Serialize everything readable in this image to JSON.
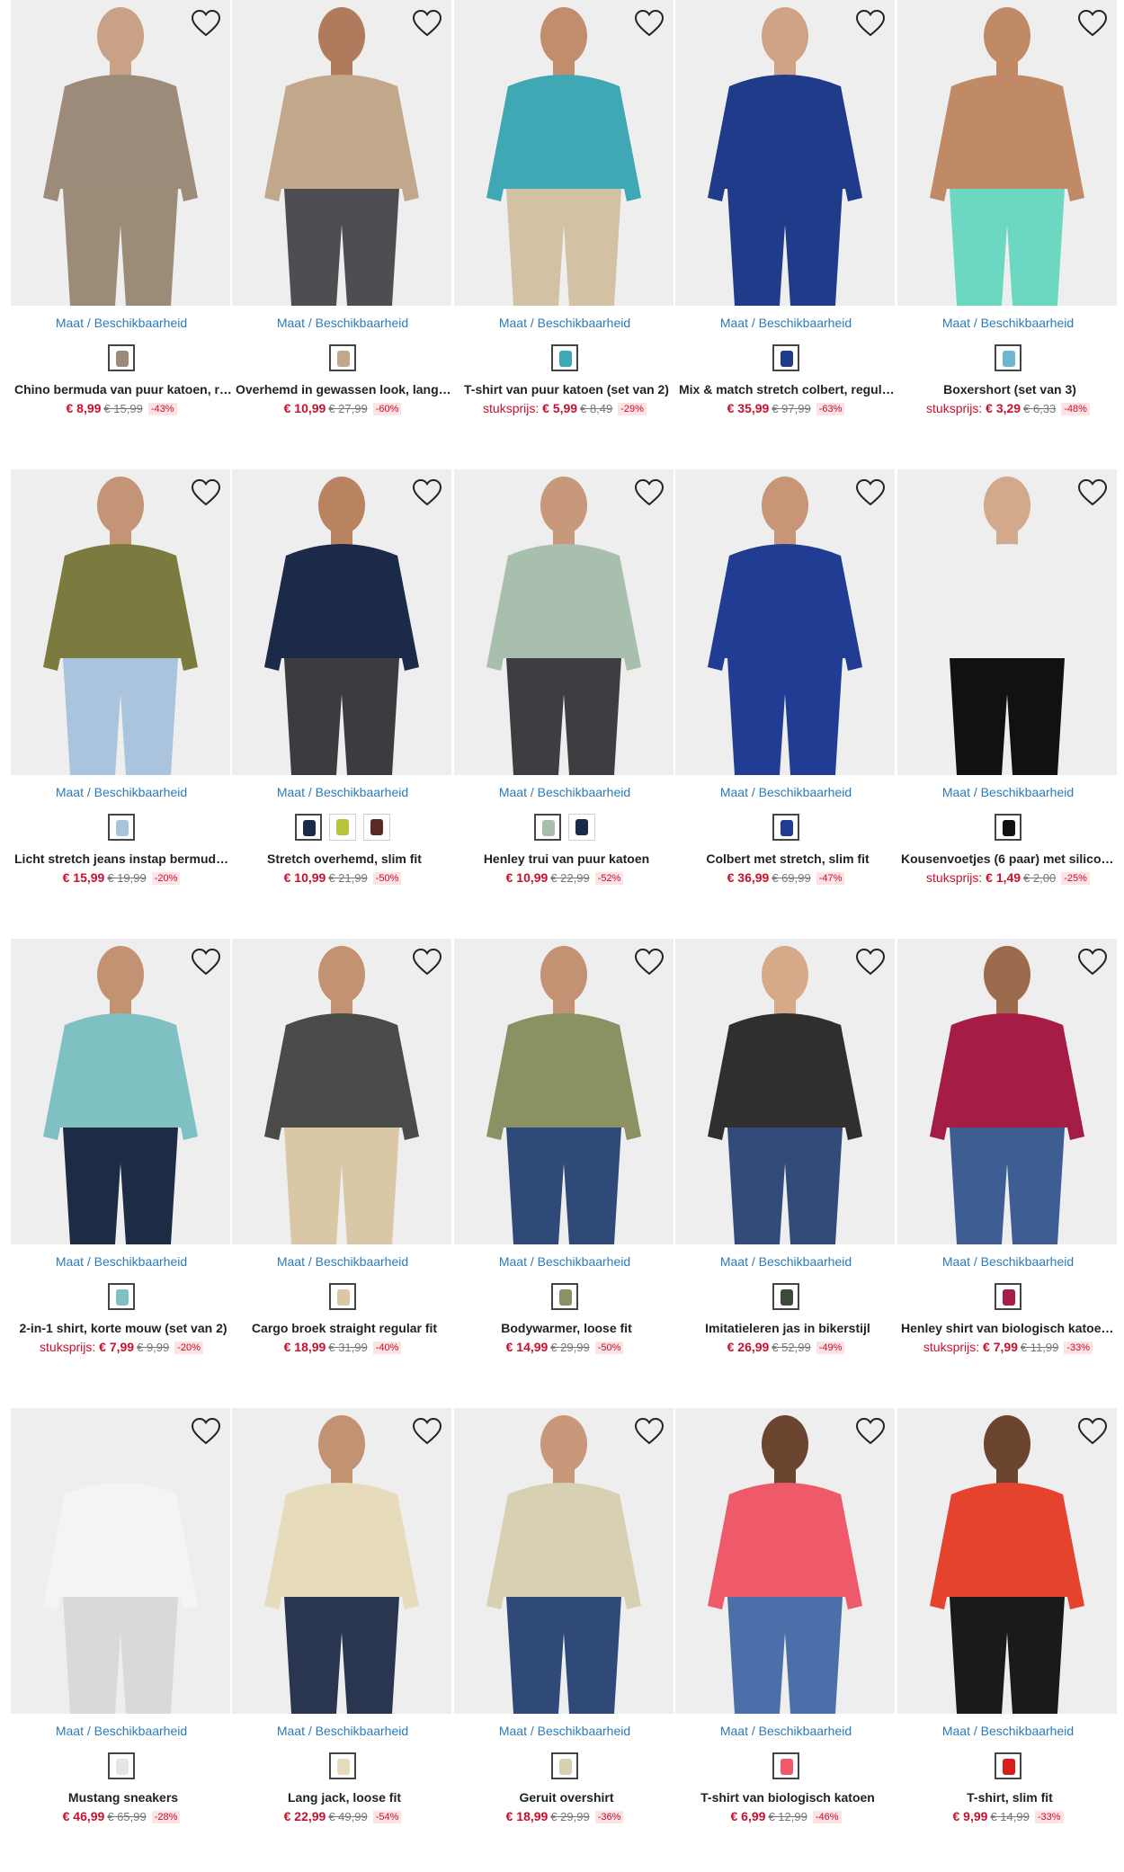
{
  "availability_label": "Maat / Beschikbaarheid",
  "unit_price_label": "stuksprijs:",
  "colors": {
    "link": "#2b7bb9",
    "sale": "#c8102e",
    "discount_bg": "#fde3e3"
  },
  "rows": [
    {
      "products": [
        {
          "title": "Chino bermuda van puur katoen, re...",
          "price": "€ 8,99",
          "old_price": "€ 15,99",
          "discount": "-43%",
          "unit_price": false,
          "skin": "#c8a187",
          "top": "#9c8b79",
          "bottom": "#9b8b77",
          "bg": "#eeeeee",
          "swatches": [
            "#9c8b79"
          ]
        },
        {
          "title": "Overhemd in gewassen look, lange ...",
          "price": "€ 10,99",
          "old_price": "€ 27,99",
          "discount": "-60%",
          "unit_price": false,
          "skin": "#b07a5c",
          "top": "#c2a88a",
          "bottom": "#4e4e52",
          "bg": "#eeeeee",
          "swatches": [
            "#c2a88a"
          ]
        },
        {
          "title": "T-shirt van puur katoen (set van 2)",
          "price": "€ 5,99",
          "old_price": "€ 8,49",
          "discount": "-29%",
          "unit_price": true,
          "skin": "#c28d6d",
          "top": "#40a7b5",
          "bottom": "#d2c1a3",
          "bg": "#eeeeee",
          "swatches": [
            "#40a7b5"
          ]
        },
        {
          "title": "Mix & match stretch colbert, regula...",
          "price": "€ 35,99",
          "old_price": "€ 97,99",
          "discount": "-63%",
          "unit_price": false,
          "skin": "#d0a386",
          "top": "#1f3b8a",
          "bottom": "#1f3b8a",
          "bg": "#eeeeee",
          "swatches": [
            "#1f3b8a"
          ]
        },
        {
          "title": "Boxershort (set van 3)",
          "price": "€ 3,29",
          "old_price": "€ 6,33",
          "discount": "-48%",
          "unit_price": true,
          "skin": "#c08a67",
          "top": "#c08a67",
          "bottom": "#6cd8c1",
          "bg": "#eeeeee",
          "swatches": [
            "#6fb6cf"
          ]
        }
      ]
    },
    {
      "products": [
        {
          "title": "Licht stretch jeans instap bermuda ,...",
          "price": "€ 15,99",
          "old_price": "€ 19,99",
          "discount": "-20%",
          "unit_price": false,
          "skin": "#c39576",
          "top": "#7b7a3f",
          "bottom": "#a9c4dc",
          "bg": "#eeeeee",
          "swatches": [
            "#a9c4dc"
          ]
        },
        {
          "title": "Stretch overhemd, slim fit",
          "price": "€ 10,99",
          "old_price": "€ 21,99",
          "discount": "-50%",
          "unit_price": false,
          "skin": "#b98362",
          "top": "#1c2a4a",
          "bottom": "#3b3b40",
          "bg": "#eeeeee",
          "swatches": [
            "#1c2a4a",
            "#b6c33b",
            "#5a2a24"
          ]
        },
        {
          "title": "Henley trui van puur katoen",
          "price": "€ 10,99",
          "old_price": "€ 22,99",
          "discount": "-52%",
          "unit_price": false,
          "skin": "#c7987a",
          "top": "#a8bfae",
          "bottom": "#3e3e42",
          "bg": "#eeeeee",
          "swatches": [
            "#a8bfae",
            "#1c2a4a"
          ]
        },
        {
          "title": "Colbert met stretch, slim fit",
          "price": "€ 36,99",
          "old_price": "€ 69,99",
          "discount": "-47%",
          "unit_price": false,
          "skin": "#c89676",
          "top": "#213c93",
          "bottom": "#213c93",
          "bg": "#eeeeee",
          "swatches": [
            "#213c93"
          ]
        },
        {
          "title": "Kousenvoetjes (6 paar) met silicone...",
          "price": "€ 1,49",
          "old_price": "€ 2,00",
          "discount": "-25%",
          "unit_price": true,
          "skin": "#d3a98c",
          "top": "#eeeeee",
          "bottom": "#111111",
          "bg": "#eeeeee",
          "swatches": [
            "#111111"
          ]
        }
      ]
    },
    {
      "products": [
        {
          "title": "2-in-1 shirt, korte mouw (set van 2)",
          "price": "€ 7,99",
          "old_price": "€ 9,99",
          "discount": "-20%",
          "unit_price": true,
          "skin": "#c39272",
          "top": "#7fc0c3",
          "bottom": "#1e2b45",
          "bg": "#eeeeee",
          "swatches": [
            "#7fc0c3"
          ]
        },
        {
          "title": "Cargo broek straight regular fit",
          "price": "€ 18,99",
          "old_price": "€ 31,99",
          "discount": "-40%",
          "unit_price": false,
          "skin": "#c39272",
          "top": "#4a4a48",
          "bottom": "#d9c7a6",
          "bg": "#eeeeee",
          "swatches": [
            "#d9c7a6"
          ]
        },
        {
          "title": "Bodywarmer, loose fit",
          "price": "€ 14,99",
          "old_price": "€ 29,99",
          "discount": "-50%",
          "unit_price": false,
          "skin": "#c39272",
          "top": "#8c9164",
          "bottom": "#2f4a79",
          "bg": "#eeeeee",
          "swatches": [
            "#8c9164"
          ]
        },
        {
          "title": "Imitatieleren jas in bikerstijl",
          "price": "€ 26,99",
          "old_price": "€ 52,99",
          "discount": "-49%",
          "unit_price": false,
          "skin": "#d6a989",
          "top": "#2f2f2f",
          "bottom": "#334b7a",
          "bg": "#eeeeee",
          "swatches": [
            "#3b4a3b"
          ]
        },
        {
          "title": "Henley shirt van biologisch katoen (...",
          "price": "€ 7,99",
          "old_price": "€ 11,99",
          "discount": "-33%",
          "unit_price": true,
          "skin": "#9c6a4d",
          "top": "#a51d45",
          "bottom": "#3d5d93",
          "bg": "#eeeeee",
          "swatches": [
            "#a51d45"
          ]
        }
      ]
    },
    {
      "products": [
        {
          "title": "Mustang sneakers",
          "price": "€ 46,99",
          "old_price": "€ 65,99",
          "discount": "-28%",
          "unit_price": false,
          "skin": "#eeeeee",
          "top": "#f4f4f4",
          "bottom": "#d9d9d9",
          "bg": "#eeeeee",
          "swatches": [
            "#e6e6e6"
          ]
        },
        {
          "title": "Lang jack, loose fit",
          "price": "€ 22,99",
          "old_price": "€ 49,99",
          "discount": "-54%",
          "unit_price": false,
          "skin": "#c39272",
          "top": "#e6dcbc",
          "bottom": "#2a3550",
          "bg": "#eeeeee",
          "swatches": [
            "#e6dcbc"
          ]
        },
        {
          "title": "Geruit overshirt",
          "price": "€ 18,99",
          "old_price": "€ 29,99",
          "discount": "-36%",
          "unit_price": false,
          "skin": "#c9977a",
          "top": "#d8d0b3",
          "bottom": "#2f4a79",
          "bg": "#eeeeee",
          "swatches": [
            "#d8d0b3"
          ]
        },
        {
          "title": "T-shirt van biologisch katoen",
          "price": "€ 6,99",
          "old_price": "€ 12,99",
          "discount": "-46%",
          "unit_price": false,
          "skin": "#6b4530",
          "top": "#ef5a6a",
          "bottom": "#4b6fa8",
          "bg": "#eeeeee",
          "swatches": [
            "#ef5a6a"
          ]
        },
        {
          "title": "T-shirt, slim fit",
          "price": "€ 9,99",
          "old_price": "€ 14,99",
          "discount": "-33%",
          "unit_price": false,
          "skin": "#6b4530",
          "top": "#e5432e",
          "bottom": "#1a1a1a",
          "bg": "#eeeeee",
          "swatches": [
            "#d81d1d"
          ]
        }
      ]
    }
  ]
}
